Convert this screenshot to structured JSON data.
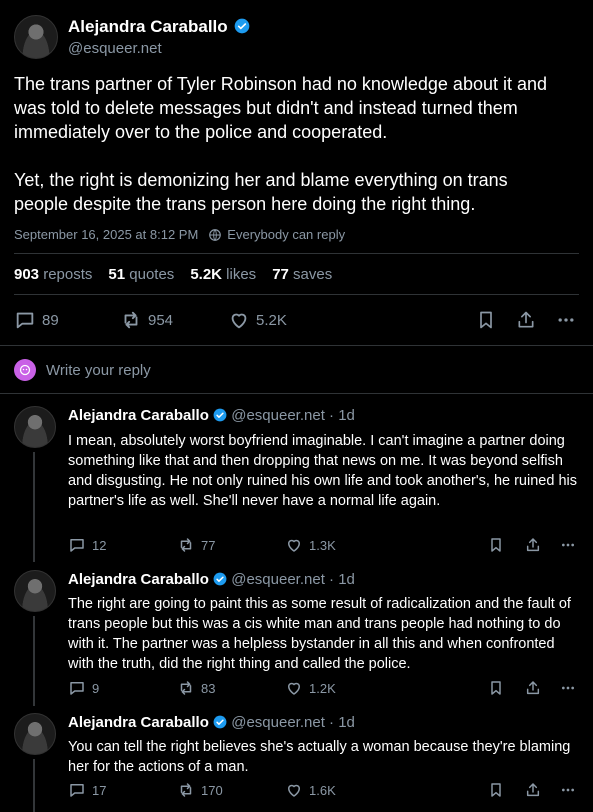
{
  "main_post": {
    "author_name": "Alejandra Caraballo",
    "handle": "@esqueer.net",
    "paragraph_1": "The trans partner of Tyler Robinson had no knowledge about it and was told to delete messages but didn't and instead turned them immediately over to the police and cooperated.",
    "paragraph_2": "Yet, the right is demonizing her and blame everything on trans people despite the trans person here doing the right thing.",
    "timestamp": "September 16, 2025 at 8:12 PM",
    "reply_setting": "Everybody can reply",
    "stats": {
      "reposts_count": "903",
      "reposts_label": "reposts",
      "quotes_count": "51",
      "quotes_label": "quotes",
      "likes_count": "5.2K",
      "likes_label": "likes",
      "saves_count": "77",
      "saves_label": "saves"
    },
    "actions": {
      "replies": "89",
      "reposts": "954",
      "likes": "5.2K"
    }
  },
  "reply_box": {
    "placeholder": "Write your reply"
  },
  "replies": [
    {
      "author_name": "Alejandra Caraballo",
      "handle": "@esqueer.net",
      "separator": "·",
      "age": "1d",
      "text": "I mean, absolutely worst boyfriend imaginable. I can't imagine a partner doing something like that and then dropping that news on me. It was beyond selfish and disgusting. He not only ruined his own life and took another's, he ruined his partner's life as well. She'll never have a normal life again.",
      "replies": "12",
      "reposts": "77",
      "likes": "1.3K"
    },
    {
      "author_name": "Alejandra Caraballo",
      "handle": "@esqueer.net",
      "separator": "·",
      "age": "1d",
      "text": "The right are going to paint this as some result of radicalization and the fault of trans people but this was a cis white man and trans people had nothing to do with it. The partner was a helpless bystander in all this and when confronted with the truth, did the right thing and called the police.",
      "replies": "9",
      "reposts": "83",
      "likes": "1.2K"
    },
    {
      "author_name": "Alejandra Caraballo",
      "handle": "@esqueer.net",
      "separator": "·",
      "age": "1d",
      "text": "You can tell the right believes she's actually a woman because they're blaming her for the actions of a man.",
      "replies": "17",
      "reposts": "170",
      "likes": "1.6K"
    }
  ],
  "colors": {
    "background": "#000000",
    "accent": "#1d9bf0",
    "muted": "#8b98a5",
    "divider": "#2f3336",
    "reply_avatar": "#c961e6"
  },
  "icons": [
    "verified-badge-icon",
    "globe-icon",
    "reply-icon",
    "repost-icon",
    "heart-icon",
    "bookmark-icon",
    "share-icon",
    "more-icon"
  ]
}
